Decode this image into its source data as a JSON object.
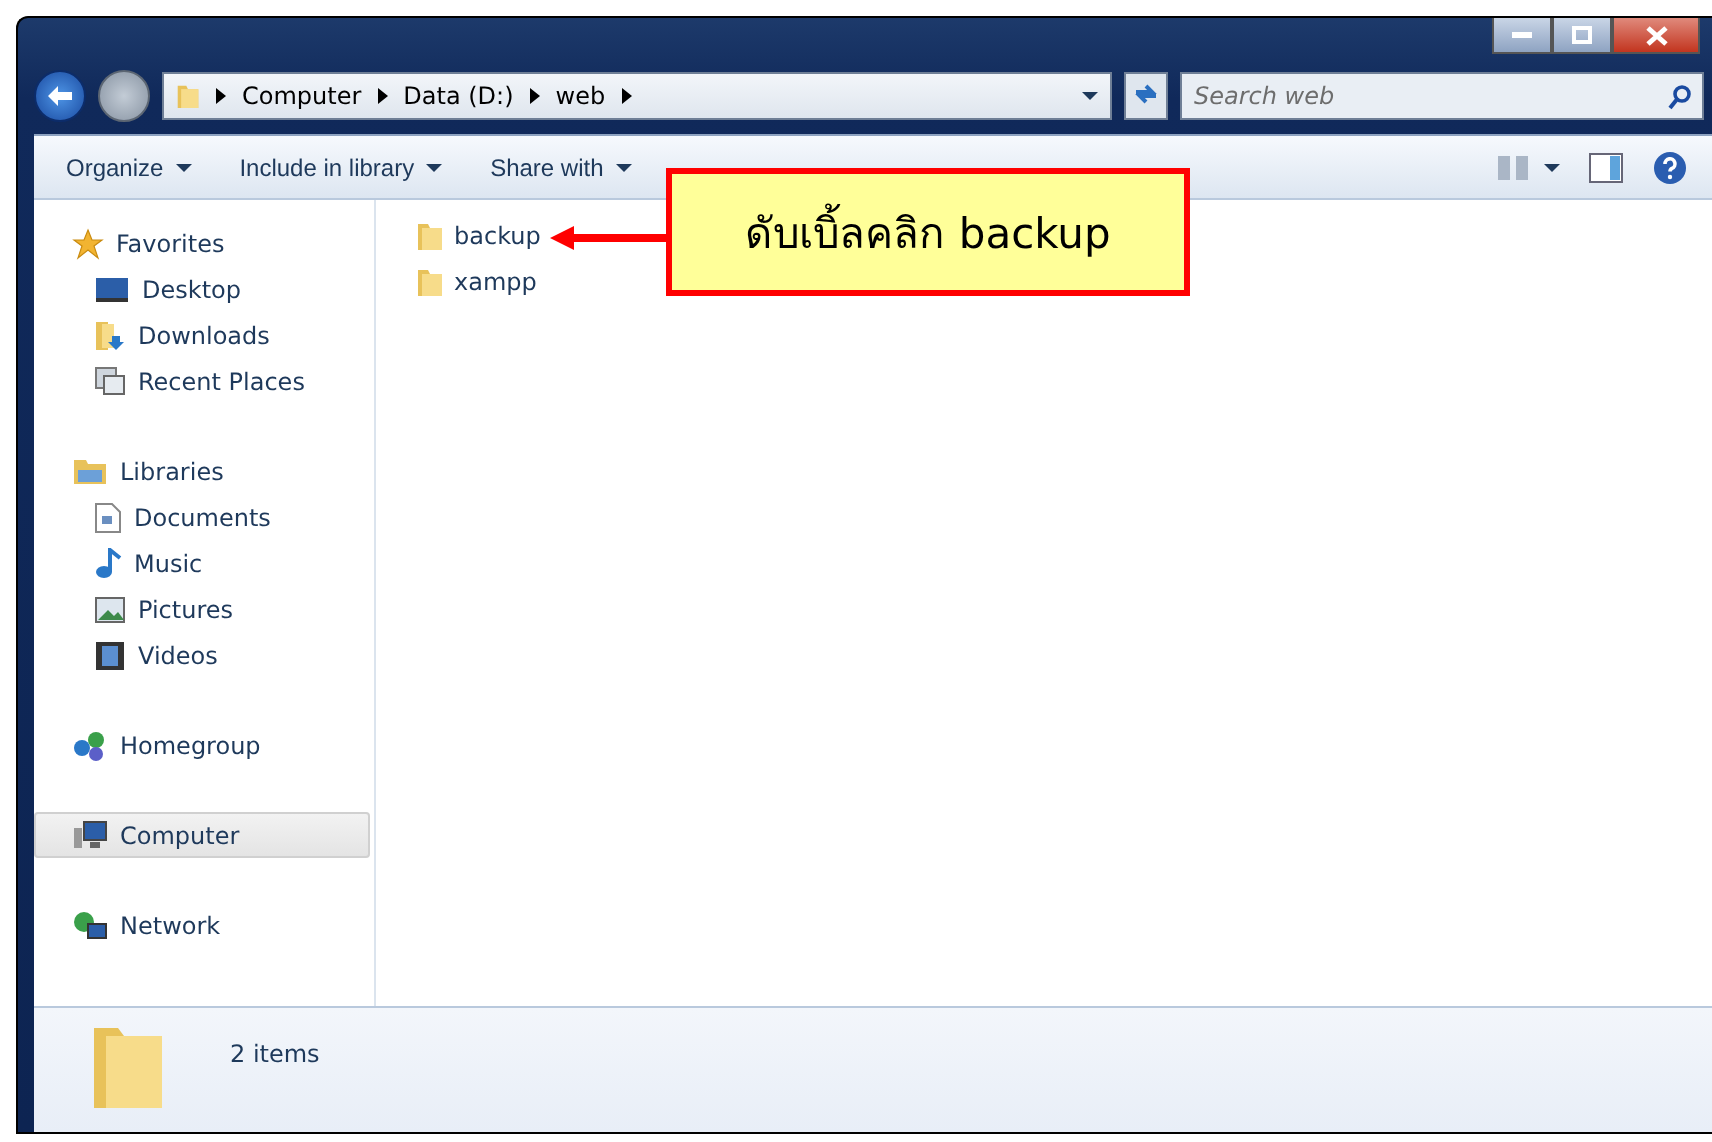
{
  "address_bar": {
    "crumbs": [
      "Computer",
      "Data (D:)",
      "web"
    ]
  },
  "search": {
    "placeholder": "Search web"
  },
  "toolbar": {
    "items": [
      "Organize",
      "Include in library",
      "Share with"
    ]
  },
  "sidebar": {
    "groups": [
      {
        "label": "Favorites",
        "selected": false,
        "children": [
          {
            "label": "Desktop",
            "selected": false
          },
          {
            "label": "Downloads",
            "selected": false
          },
          {
            "label": "Recent Places",
            "selected": false
          }
        ]
      },
      {
        "label": "Libraries",
        "selected": false,
        "children": [
          {
            "label": "Documents",
            "selected": false
          },
          {
            "label": "Music",
            "selected": false
          },
          {
            "label": "Pictures",
            "selected": false
          },
          {
            "label": "Videos",
            "selected": false
          }
        ]
      },
      {
        "label": "Homegroup",
        "selected": false
      },
      {
        "label": "Computer",
        "selected": true
      },
      {
        "label": "Network",
        "selected": false
      }
    ]
  },
  "files": [
    {
      "name": "backup"
    },
    {
      "name": "xampp"
    }
  ],
  "callout": {
    "text": "ดับเบิ้ลคลิก backup"
  },
  "status_bar": {
    "count": "2 items"
  }
}
